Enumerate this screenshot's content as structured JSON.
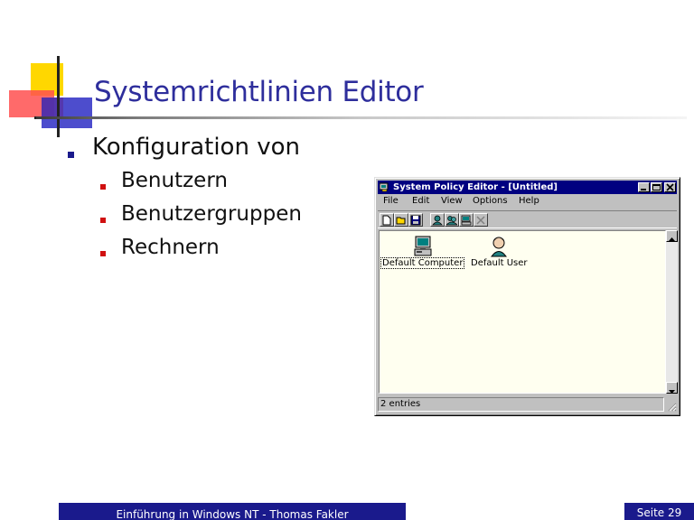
{
  "slide": {
    "title": "Systemrichtlinien Editor",
    "bullet_level1": "Konfiguration von",
    "bullets_level2": [
      "Benutzern",
      "Benutzergruppen",
      "Rechnern"
    ]
  },
  "window": {
    "title": "System Policy Editor - [Untitled]",
    "menu": [
      "File",
      "Edit",
      "View",
      "Options",
      "Help"
    ],
    "entries": [
      {
        "label": "Default Computer",
        "icon": "computer-icon"
      },
      {
        "label": "Default User",
        "icon": "user-icon"
      }
    ],
    "status": "2 entries"
  },
  "footer": {
    "left": "Einführung in Windows NT - Thomas Fakler",
    "right": "Seite 29"
  },
  "colors": {
    "title": "#2e2e9c",
    "bullet_level1": "#1a1a8c",
    "bullet_level2": "#d01010",
    "footer_bg": "#1a1a8c",
    "window_titlebar": "#000080",
    "window_content": "#fffff0"
  }
}
